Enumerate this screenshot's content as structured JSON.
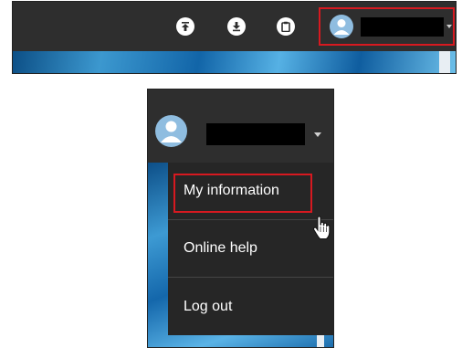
{
  "toolbar": {
    "icons": [
      "upload-icon",
      "download-icon",
      "clipboard-icon"
    ]
  },
  "user": {
    "avatar_icon": "user-avatar-icon",
    "dropdown_icon": "caret-down-icon"
  },
  "menu": {
    "items": [
      {
        "label": "My information"
      },
      {
        "label": "Online help"
      },
      {
        "label": "Log out"
      }
    ]
  },
  "colors": {
    "bar": "#2e2e2e",
    "menu_bg": "#262626",
    "highlight": "#d71920",
    "avatar": "#8fbde0"
  }
}
